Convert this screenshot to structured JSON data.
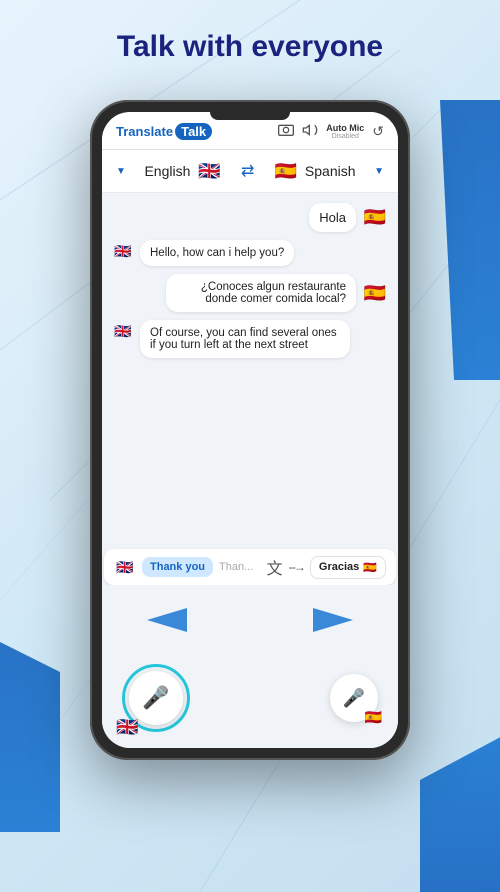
{
  "page": {
    "title": "Talk with everyone",
    "background_color": "#d8ecf8"
  },
  "app": {
    "logo_translate": "Translate",
    "logo_talk": "Talk",
    "header_icons": {
      "camera": "📷",
      "volume": "🔊",
      "auto_mic_label": "Auto Mic",
      "disabled_label": "Disabled",
      "reset": "↺"
    },
    "lang_selector": {
      "source_lang": "English",
      "source_flag": "🇬🇧",
      "target_lang": "Spanish",
      "target_flag": "🇪🇸"
    },
    "messages": [
      {
        "id": 1,
        "side": "right",
        "text": "Hola",
        "flag": "🇪🇸"
      },
      {
        "id": 2,
        "side": "left",
        "text": "Hello, how can i help you?",
        "flag": "🇬🇧"
      },
      {
        "id": 3,
        "side": "right",
        "text": "¿Conoces algun restaurante donde comer comida local?",
        "flag": "🇪🇸"
      },
      {
        "id": 4,
        "side": "left",
        "text": "Of course, you can find several ones if you turn left at the next street",
        "flag": "🇬🇧"
      }
    ],
    "translation_bar": {
      "source_text": "Thank you",
      "placeholder": "Than...",
      "translate_icon": "译",
      "arrow": "- - →",
      "result_text": "Gracias",
      "result_flag": "🇪🇸"
    },
    "nav_arrows": {
      "left_label": "left arrow",
      "right_label": "right arrow"
    },
    "mic_area": {
      "source_flag": "🇬🇧",
      "target_flag": "🇪🇸"
    }
  }
}
